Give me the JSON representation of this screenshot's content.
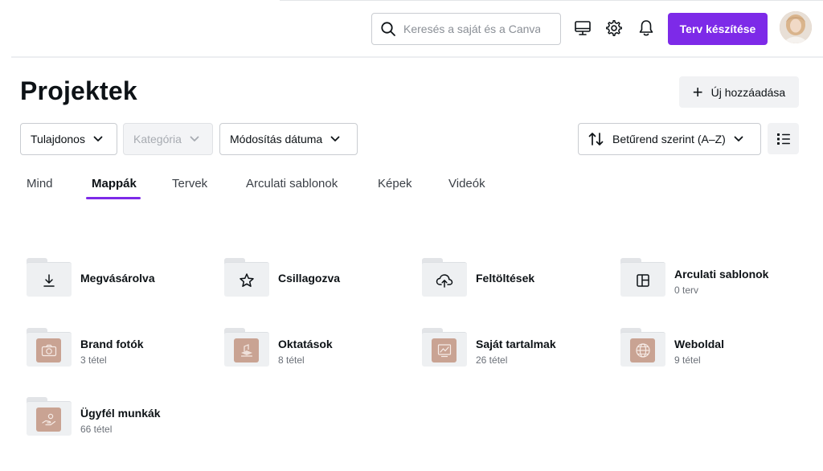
{
  "search": {
    "placeholder": "Keresés a saját és a Canva tartalmaiban"
  },
  "topbar": {
    "icons": [
      "desktop-icon",
      "gear-icon",
      "bell-icon"
    ],
    "create_label": "Terv készítése"
  },
  "header": {
    "title": "Projektek",
    "add_label": "Új hozzáadása"
  },
  "filters": {
    "owner": "Tulajdonos",
    "category": "Kategória",
    "modified": "Módosítás dátuma",
    "sort": "Betűrend szerint (A–Z)"
  },
  "tabs": [
    {
      "label": "Mind"
    },
    {
      "label": "Mappák"
    },
    {
      "label": "Tervek"
    },
    {
      "label": "Arculati sablonok"
    },
    {
      "label": "Képek"
    },
    {
      "label": "Videók"
    }
  ],
  "active_tab": "Mappák",
  "folders": [
    {
      "name": "Megvásárolva",
      "count": "",
      "icon": "download-icon"
    },
    {
      "name": "Csillagozva",
      "count": "",
      "icon": "star-icon"
    },
    {
      "name": "Feltöltések",
      "count": "",
      "icon": "cloud-upload-icon"
    },
    {
      "name": "Arculati sablonok",
      "count": "0 terv",
      "icon": "template-icon"
    },
    {
      "name": "Brand fotók",
      "count": "3 tétel",
      "icon": "camera-icon"
    },
    {
      "name": "Oktatások",
      "count": "8 tétel",
      "icon": "education-icon"
    },
    {
      "name": "Saját tartalmak",
      "count": "26 tétel",
      "icon": "content-icon"
    },
    {
      "name": "Weboldal",
      "count": "9 tétel",
      "icon": "globe-icon"
    },
    {
      "name": "Ügyfél munkák",
      "count": "66 tétel",
      "icon": "hand-icon"
    }
  ],
  "colors": {
    "accent": "#7d2ae8",
    "folder_thumb": "#c9a393"
  }
}
